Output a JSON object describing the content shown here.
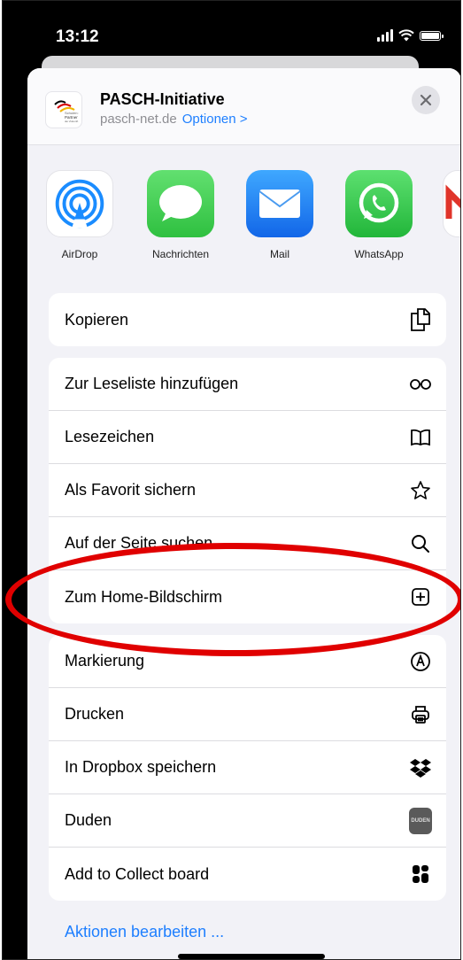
{
  "status_bar": {
    "time": "13:12",
    "signal_icon": "cellular-signal-icon",
    "wifi_icon": "wifi-icon",
    "battery_icon": "battery-icon"
  },
  "share_header": {
    "title": "PASCH-Initiative",
    "domain": "pasch-net.de",
    "options_label": "Optionen >",
    "logo_text": [
      "Schulen:",
      "Partner",
      "der Zukunft"
    ],
    "close_icon": "close-icon"
  },
  "share_apps": [
    {
      "label": "AirDrop",
      "icon": "airdrop-icon"
    },
    {
      "label": "Nachrichten",
      "icon": "messages-icon"
    },
    {
      "label": "Mail",
      "icon": "mail-icon"
    },
    {
      "label": "WhatsApp",
      "icon": "whatsapp-icon"
    }
  ],
  "action_groups": [
    [
      {
        "label": "Kopieren",
        "icon": "copy-icon"
      }
    ],
    [
      {
        "label": "Zur Leseliste hinzufügen",
        "icon": "glasses-icon"
      },
      {
        "label": "Lesezeichen",
        "icon": "book-icon"
      },
      {
        "label": "Als Favorit sichern",
        "icon": "star-icon"
      },
      {
        "label": "Auf der Seite suchen",
        "icon": "search-icon"
      },
      {
        "label": "Zum Home-Bildschirm",
        "icon": "add-square-icon"
      }
    ],
    [
      {
        "label": "Markierung",
        "icon": "markup-icon"
      },
      {
        "label": "Drucken",
        "icon": "printer-icon"
      },
      {
        "label": "In Dropbox speichern",
        "icon": "dropbox-icon"
      },
      {
        "label": "Duden",
        "icon": "duden-icon",
        "icon_text": "DUDEN"
      },
      {
        "label": "Add to Collect board",
        "icon": "collect-icon"
      }
    ]
  ],
  "edit_actions_label": "Aktionen bearbeiten ...",
  "highlight": {
    "color": "#e00000",
    "target": "Zum Home-Bildschirm"
  },
  "colors": {
    "accent": "#1e7fff",
    "sheet_background": "#f2f2f7"
  }
}
